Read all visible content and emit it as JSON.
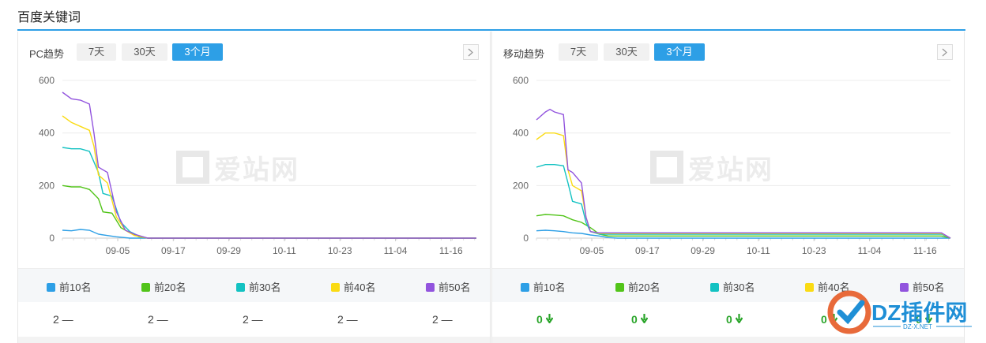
{
  "page_title": "百度关键词",
  "watermark": "爱站网",
  "corner_logo": {
    "text": "DZ插件网",
    "sub": "DZ-X.NET"
  },
  "panels": [
    {
      "label": "PC趋势",
      "tabs": [
        {
          "label": "7天",
          "active": false
        },
        {
          "label": "30天",
          "active": false
        },
        {
          "label": "3个月",
          "active": true
        }
      ],
      "chart_data": {
        "type": "line",
        "ylim": [
          0,
          600
        ],
        "yticks": [
          "600",
          "400",
          "200",
          "0"
        ],
        "xticks": [
          "09-05",
          "09-17",
          "09-29",
          "10-11",
          "10-23",
          "11-04",
          "11-16"
        ],
        "series": [
          {
            "name": "前10名",
            "color": "#2d9fe6",
            "points": [
              [
                0,
                30
              ],
              [
                2,
                28
              ],
              [
                4,
                33
              ],
              [
                6,
                30
              ],
              [
                8,
                15
              ],
              [
                10,
                10
              ],
              [
                12,
                5
              ],
              [
                15,
                0
              ],
              [
                92,
                0
              ]
            ]
          },
          {
            "name": "前20名",
            "color": "#52c41a",
            "points": [
              [
                0,
                200
              ],
              [
                2,
                195
              ],
              [
                4,
                195
              ],
              [
                6,
                185
              ],
              [
                8,
                150
              ],
              [
                9,
                100
              ],
              [
                11,
                95
              ],
              [
                13,
                40
              ],
              [
                15,
                20
              ],
              [
                17,
                5
              ],
              [
                19,
                0
              ],
              [
                92,
                0
              ]
            ]
          },
          {
            "name": "前30名",
            "color": "#13c2c2",
            "points": [
              [
                0,
                345
              ],
              [
                2,
                340
              ],
              [
                4,
                340
              ],
              [
                6,
                330
              ],
              [
                8,
                250
              ],
              [
                9,
                170
              ],
              [
                11,
                160
              ],
              [
                13,
                60
              ],
              [
                15,
                25
              ],
              [
                17,
                8
              ],
              [
                19,
                0
              ],
              [
                92,
                0
              ]
            ]
          },
          {
            "name": "前40名",
            "color": "#fadb14",
            "points": [
              [
                0,
                465
              ],
              [
                2,
                440
              ],
              [
                4,
                425
              ],
              [
                6,
                410
              ],
              [
                7,
                350
              ],
              [
                8,
                240
              ],
              [
                10,
                210
              ],
              [
                12,
                80
              ],
              [
                14,
                30
              ],
              [
                16,
                10
              ],
              [
                19,
                0
              ],
              [
                92,
                0
              ]
            ]
          },
          {
            "name": "前50名",
            "color": "#9254de",
            "points": [
              [
                0,
                555
              ],
              [
                2,
                530
              ],
              [
                4,
                525
              ],
              [
                6,
                510
              ],
              [
                7,
                400
              ],
              [
                8,
                270
              ],
              [
                10,
                250
              ],
              [
                12,
                100
              ],
              [
                14,
                30
              ],
              [
                16,
                15
              ],
              [
                19,
                0
              ],
              [
                92,
                0
              ]
            ]
          }
        ]
      },
      "values": [
        "2 —",
        "2 —",
        "2 —",
        "2 —",
        "2 —"
      ]
    },
    {
      "label": "移动趋势",
      "tabs": [
        {
          "label": "7天",
          "active": false
        },
        {
          "label": "30天",
          "active": false
        },
        {
          "label": "3个月",
          "active": true
        }
      ],
      "chart_data": {
        "type": "line",
        "ylim": [
          0,
          600
        ],
        "yticks": [
          "600",
          "400",
          "200",
          "0"
        ],
        "xticks": [
          "09-05",
          "09-17",
          "09-29",
          "10-11",
          "10-23",
          "11-04",
          "11-16"
        ],
        "series": [
          {
            "name": "前10名",
            "color": "#2d9fe6",
            "points": [
              [
                0,
                28
              ],
              [
                2,
                30
              ],
              [
                4,
                28
              ],
              [
                6,
                25
              ],
              [
                8,
                20
              ],
              [
                10,
                18
              ],
              [
                12,
                12
              ],
              [
                14,
                8
              ],
              [
                16,
                2
              ],
              [
                18,
                0
              ],
              [
                90,
                0
              ],
              [
                92,
                0
              ]
            ]
          },
          {
            "name": "前20名",
            "color": "#52c41a",
            "points": [
              [
                0,
                85
              ],
              [
                2,
                90
              ],
              [
                4,
                88
              ],
              [
                6,
                85
              ],
              [
                8,
                70
              ],
              [
                10,
                60
              ],
              [
                12,
                40
              ],
              [
                14,
                15
              ],
              [
                16,
                8
              ],
              [
                18,
                8
              ],
              [
                90,
                8
              ],
              [
                92,
                0
              ]
            ]
          },
          {
            "name": "前30名",
            "color": "#13c2c2",
            "points": [
              [
                0,
                270
              ],
              [
                2,
                280
              ],
              [
                4,
                280
              ],
              [
                6,
                275
              ],
              [
                7,
                210
              ],
              [
                8,
                140
              ],
              [
                10,
                130
              ],
              [
                11,
                60
              ],
              [
                12,
                25
              ],
              [
                14,
                15
              ],
              [
                90,
                15
              ],
              [
                92,
                0
              ]
            ]
          },
          {
            "name": "前40名",
            "color": "#fadb14",
            "points": [
              [
                0,
                375
              ],
              [
                2,
                400
              ],
              [
                4,
                400
              ],
              [
                6,
                390
              ],
              [
                7,
                260
              ],
              [
                8,
                200
              ],
              [
                10,
                180
              ],
              [
                11,
                80
              ],
              [
                12,
                25
              ],
              [
                14,
                18
              ],
              [
                90,
                18
              ],
              [
                92,
                0
              ]
            ]
          },
          {
            "name": "前50名",
            "color": "#9254de",
            "points": [
              [
                0,
                450
              ],
              [
                2,
                480
              ],
              [
                3,
                490
              ],
              [
                4,
                480
              ],
              [
                6,
                470
              ],
              [
                7,
                260
              ],
              [
                8,
                250
              ],
              [
                10,
                210
              ],
              [
                11,
                80
              ],
              [
                12,
                25
              ],
              [
                14,
                20
              ],
              [
                90,
                20
              ],
              [
                92,
                0
              ]
            ]
          }
        ]
      },
      "values": [
        "0",
        "0",
        "0",
        "0",
        "0"
      ]
    }
  ],
  "legend": [
    {
      "label": "前10名",
      "color": "#2d9fe6"
    },
    {
      "label": "前20名",
      "color": "#52c41a"
    },
    {
      "label": "前30名",
      "color": "#13c2c2"
    },
    {
      "label": "前40名",
      "color": "#fadb14"
    },
    {
      "label": "前50名",
      "color": "#9254de"
    }
  ]
}
